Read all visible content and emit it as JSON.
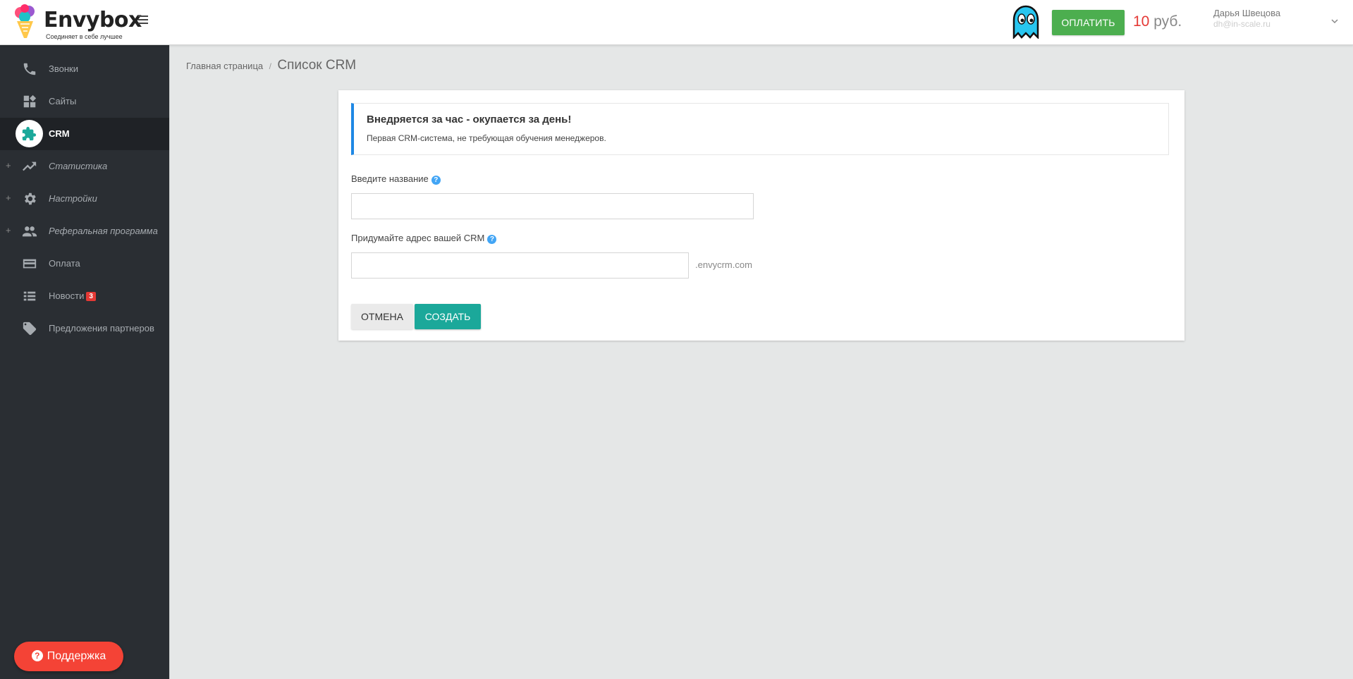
{
  "header": {
    "logo_name": "Envybox",
    "logo_tagline": "Соединяет в себе лучшее",
    "pay_label": "ОПЛАТИТЬ",
    "balance_amount": "10",
    "balance_currency": "руб.",
    "user_name": "Дарья Швецова",
    "user_email": "dh@in-scale.ru"
  },
  "sidebar": {
    "items": [
      {
        "label": "Звонки",
        "icon": "phone-icon",
        "expandable": false,
        "active": false
      },
      {
        "label": "Сайты",
        "icon": "dashboard-icon",
        "expandable": false,
        "active": false
      },
      {
        "label": "CRM",
        "icon": "puzzle-icon",
        "expandable": false,
        "active": true
      },
      {
        "label": "Статистика",
        "icon": "trending-up-icon",
        "expandable": true,
        "active": false
      },
      {
        "label": "Настройки",
        "icon": "gear-icon",
        "expandable": true,
        "active": false
      },
      {
        "label": "Реферальная программа",
        "icon": "people-icon",
        "expandable": true,
        "active": false
      },
      {
        "label": "Оплата",
        "icon": "credit-card-icon",
        "expandable": false,
        "active": false
      },
      {
        "label": "Новости",
        "icon": "list-icon",
        "expandable": false,
        "active": false,
        "badge": "3"
      },
      {
        "label": "Предложения партнеров",
        "icon": "tag-icon",
        "expandable": false,
        "active": false
      }
    ],
    "support_label": "Поддержка"
  },
  "breadcrumb": {
    "home": "Главная страница",
    "separator": "/",
    "current": "Список CRM"
  },
  "form": {
    "info_title": "Внедряется за час - окупается за день!",
    "info_text": "Первая CRM-система, не требующая обучения менеджеров.",
    "name_label": "Введите название",
    "name_value": "",
    "address_label": "Придумайте адрес вашей CRM",
    "address_value": "",
    "address_suffix": ".envycrm.com",
    "cancel_label": "ОТМЕНА",
    "create_label": "СОЗДАТЬ"
  },
  "colors": {
    "sidebar_bg": "#2a2e33",
    "pay_green": "#4cae4f",
    "create_teal": "#1ba89a",
    "support_red": "#f44336",
    "info_accent": "#1e88e5",
    "badge_red": "#e53935"
  }
}
